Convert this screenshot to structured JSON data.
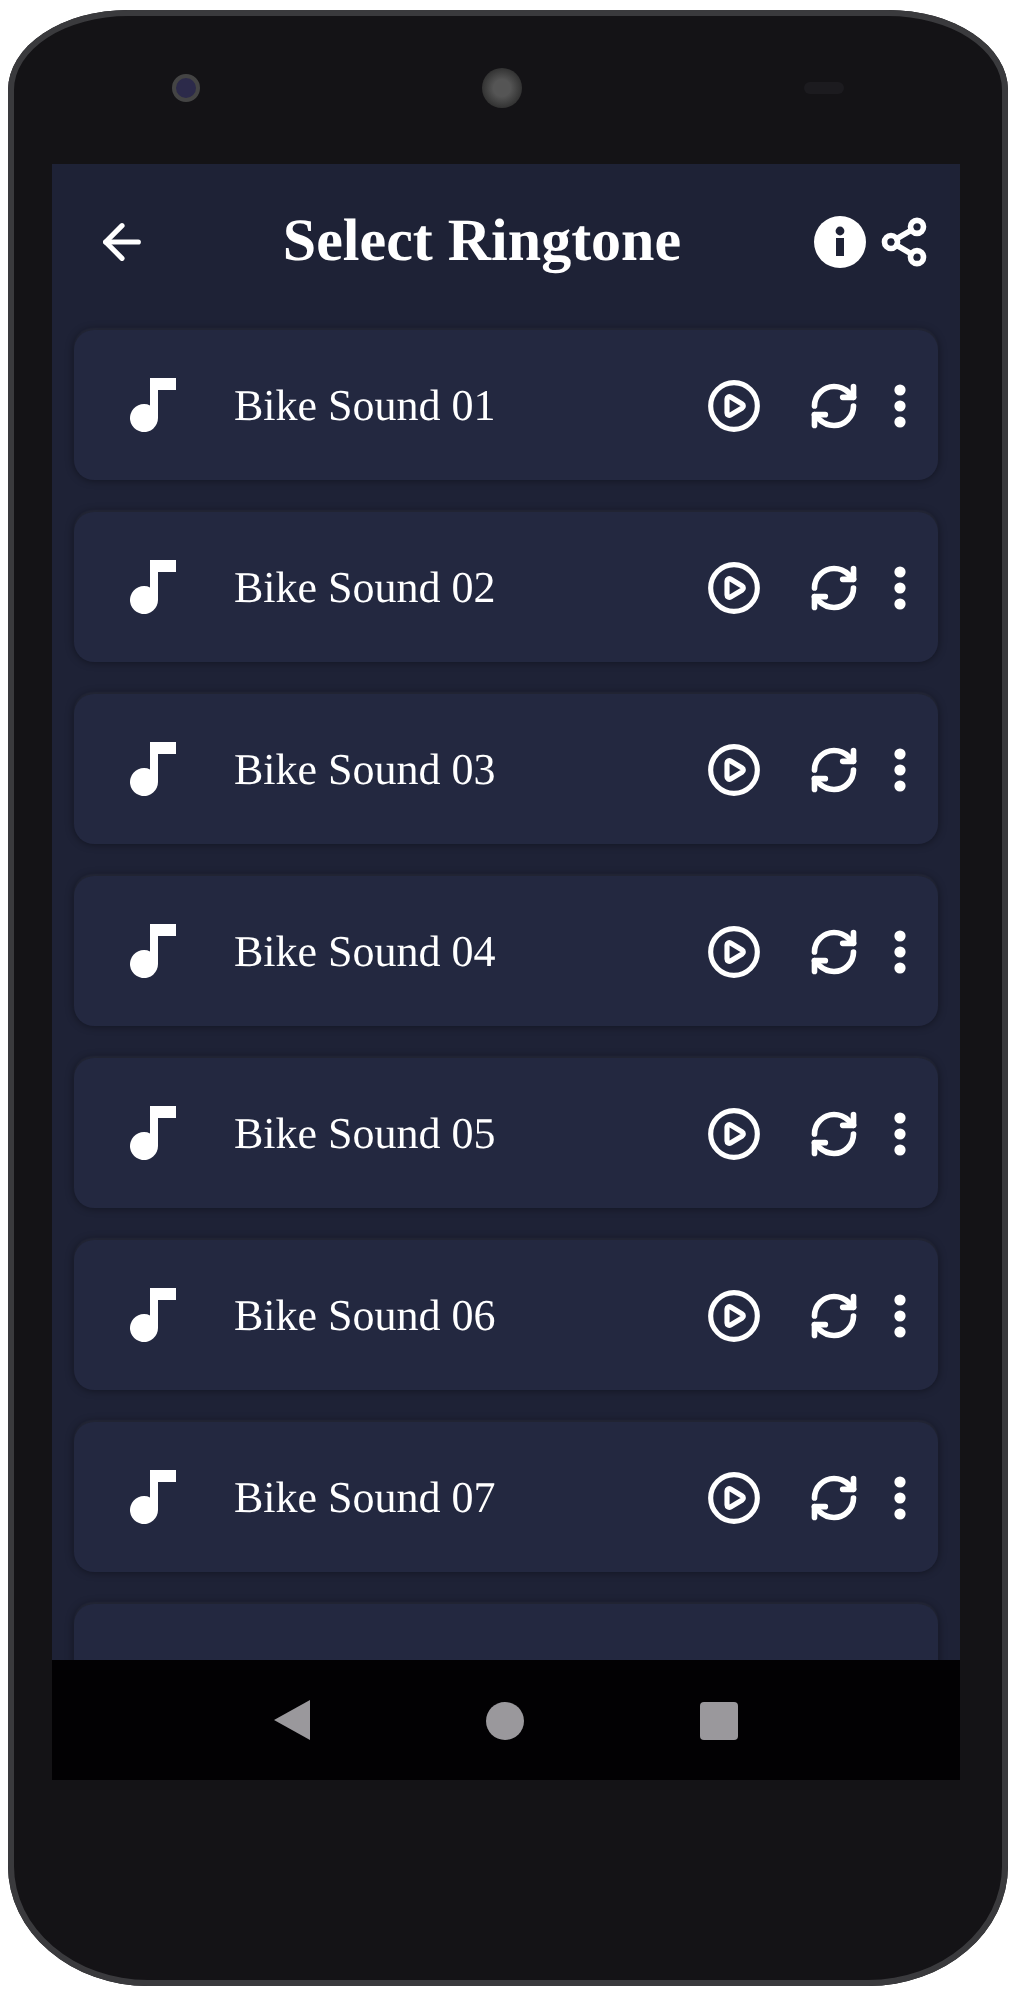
{
  "app_bar": {
    "title": "Select Ringtone"
  },
  "ringtones": [
    {
      "title": "Bike Sound 01"
    },
    {
      "title": "Bike Sound 02"
    },
    {
      "title": "Bike Sound 03"
    },
    {
      "title": "Bike Sound 04"
    },
    {
      "title": "Bike Sound 05"
    },
    {
      "title": "Bike Sound 06"
    },
    {
      "title": "Bike Sound 07"
    },
    {
      "kind": "cut"
    }
  ]
}
